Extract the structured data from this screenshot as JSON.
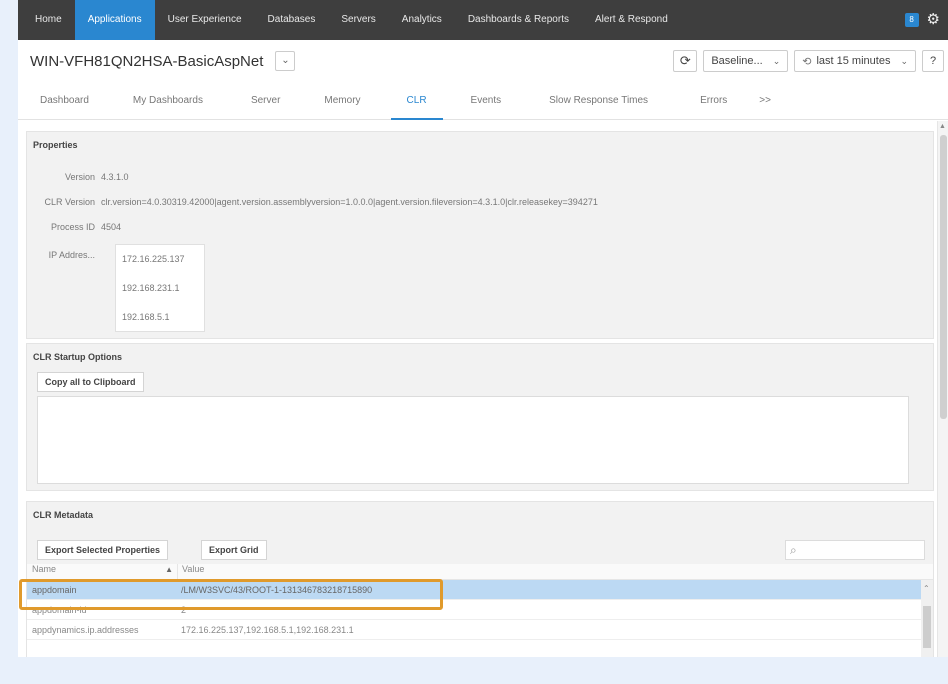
{
  "topnav": {
    "items": [
      "Home",
      "Applications",
      "User Experience",
      "Databases",
      "Servers",
      "Analytics",
      "Dashboards & Reports",
      "Alert & Respond"
    ],
    "active_index": 1,
    "badge": "8"
  },
  "titlebar": {
    "app_name": "WIN-VFH81QN2HSA-BasicAspNet",
    "baseline_label": "Baseline...",
    "time_range_label": "last 15 minutes",
    "help_label": "?"
  },
  "tabs": {
    "items": [
      "Dashboard",
      "My Dashboards",
      "Server",
      "Memory",
      "CLR",
      "Events",
      "Slow Response Times",
      "Errors",
      ">>"
    ],
    "active_index": 4
  },
  "properties": {
    "title": "Properties",
    "version_label": "Version",
    "version_value": "4.3.1.0",
    "clr_version_label": "CLR Version",
    "clr_version_value": "clr.version=4.0.30319.42000|agent.version.assemblyversion=1.0.0.0|agent.version.fileversion=4.3.1.0|clr.releasekey=394271",
    "process_id_label": "Process ID",
    "process_id_value": "4504",
    "ip_label": "IP Addres...",
    "ip_addresses": [
      "172.16.225.137",
      "192.168.231.1",
      "192.168.5.1"
    ]
  },
  "startup": {
    "title": "CLR Startup Options",
    "copy_button": "Copy all to Clipboard"
  },
  "metadata": {
    "title": "CLR Metadata",
    "export_selected_button": "Export Selected Properties",
    "export_grid_button": "Export Grid",
    "search_placeholder": "",
    "columns": [
      "Name",
      "Value"
    ],
    "rows": [
      {
        "name": "appdomain",
        "value": "/LM/W3SVC/43/ROOT-1-131346783218715890"
      },
      {
        "name": "appdomain-id",
        "value": "2"
      },
      {
        "name": "appdynamics.ip.addresses",
        "value": "172.16.225.137,192.168.5.1,192.168.231.1"
      }
    ],
    "selected_row": 0
  },
  "colors": {
    "accent": "#2a87d0",
    "nav_bg": "#3e3e3e",
    "highlight": "#e09a2c",
    "selected_row": "#bcd9f3"
  }
}
